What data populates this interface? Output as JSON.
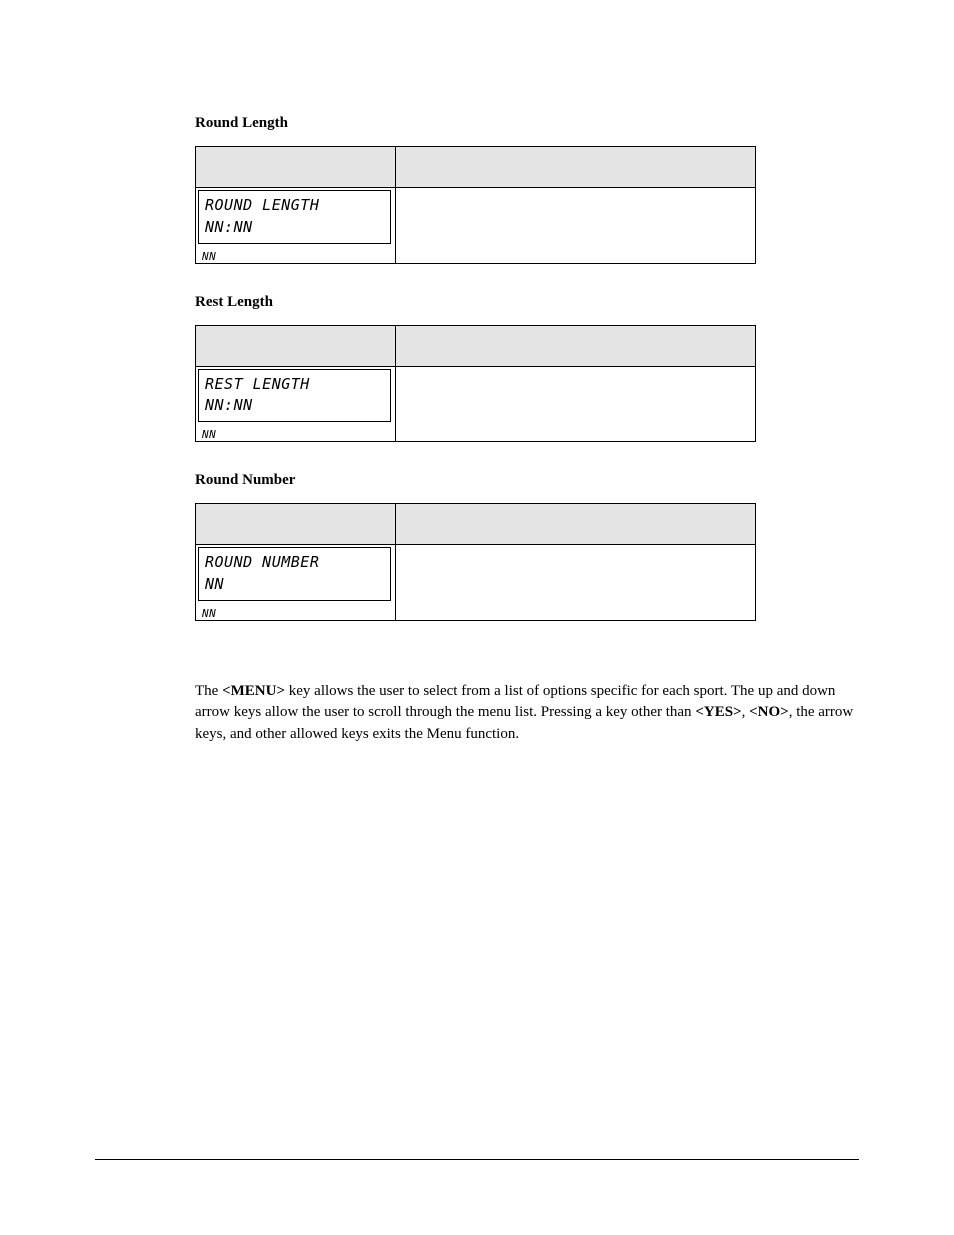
{
  "sections": [
    {
      "heading": "Round Length",
      "lcd_line1": "ROUND LENGTH",
      "lcd_line2": " NN:NN",
      "below": "NN"
    },
    {
      "heading": "Rest Length",
      "lcd_line1": "REST LENGTH",
      "lcd_line2": " NN:NN",
      "below": "NN"
    },
    {
      "heading": "Round Number",
      "lcd_line1": "ROUND NUMBER",
      "lcd_line2": " NN",
      "below": "NN"
    }
  ],
  "paragraph": {
    "p1": "The ",
    "k1": "<MENU>",
    "p2": " key allows the user to select from a list of options specific for each sport.  The up and down arrow keys allow the user to scroll through the menu list.  Pressing a key other than ",
    "k2": "<YES>",
    "p3": ", ",
    "k3": "<NO>",
    "p4": ", the arrow keys, and other allowed keys exits the Menu function."
  }
}
